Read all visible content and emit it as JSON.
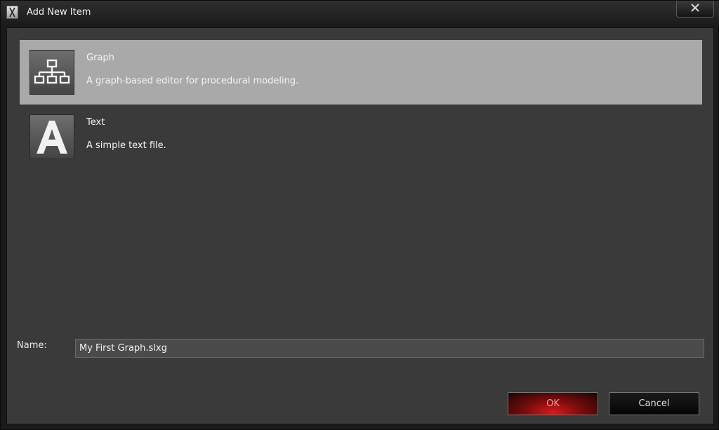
{
  "window": {
    "title": "Add New Item",
    "close_label": "✕"
  },
  "items": [
    {
      "title": "Graph",
      "description": "A graph-based editor for procedural modeling.",
      "icon": "graph-hierarchy-icon",
      "selected": true
    },
    {
      "title": "Text",
      "description": "A simple text file.",
      "icon": "text-letter-a-icon",
      "icon_glyph": "A",
      "selected": false
    }
  ],
  "name_field": {
    "label": "Name:",
    "value": "My First Graph.slxg"
  },
  "buttons": {
    "ok_label": "OK",
    "cancel_label": "Cancel"
  },
  "colors": {
    "selection": "#a9a9a9",
    "ok_accent": "#d61a1a"
  }
}
